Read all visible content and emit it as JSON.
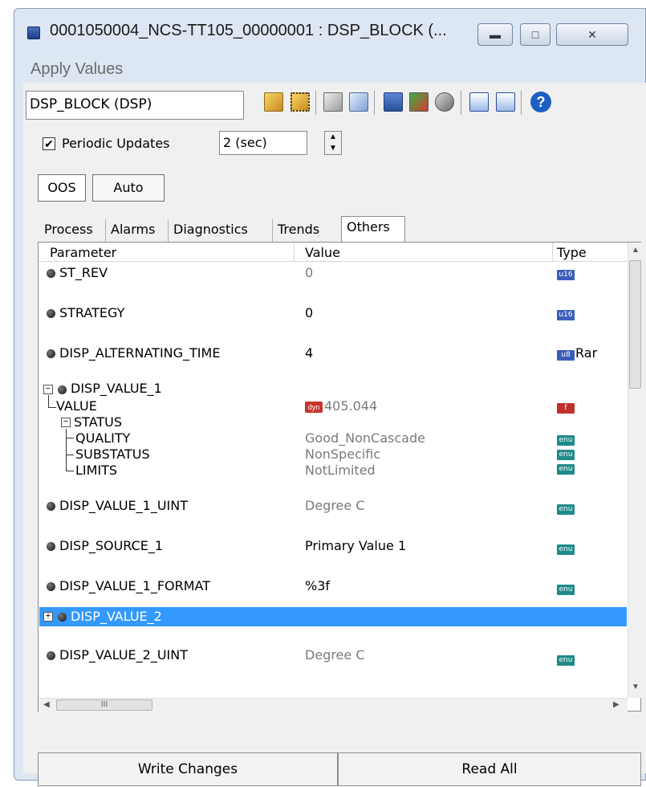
{
  "window": {
    "title": "0001050004_NCS-TT105_00000001 : DSP_BLOCK (..."
  },
  "menu": {
    "apply_values": "Apply Values"
  },
  "toolbar": {
    "block_name": "DSP_BLOCK (DSP)",
    "help_label": "?"
  },
  "controls": {
    "periodic_updates_label": "Periodic Updates",
    "periodic_updates_checked": true,
    "check_mark": "✔",
    "interval_value": "2 (sec)",
    "spin_up": "▲",
    "spin_down": "▼",
    "oos_label": "OOS",
    "auto_label": "Auto"
  },
  "tabs": [
    "Process",
    "Alarms",
    "Diagnostics",
    "Trends",
    "Others"
  ],
  "active_tab": "Others",
  "grid": {
    "columns": {
      "parameter": "Parameter",
      "value": "Value",
      "type": "Type"
    },
    "rows": {
      "st_rev": {
        "param": "ST_REV",
        "value": "0",
        "type": "u16"
      },
      "strategy": {
        "param": "STRATEGY",
        "value": "0",
        "type": "u16"
      },
      "disp_alt": {
        "param": "DISP_ALTERNATING_TIME",
        "value": "4",
        "type": "u8",
        "type_extra": "Rar"
      },
      "disp_value_1": {
        "param": "DISP_VALUE_1",
        "expand": "⊟"
      },
      "value": {
        "param": "VALUE",
        "value": "405.044",
        "dyn": "dyn",
        "type": "f"
      },
      "status": {
        "param": "STATUS"
      },
      "quality": {
        "param": "QUALITY",
        "value": "Good_NonCascade",
        "type": "enu"
      },
      "substatus": {
        "param": "SUBSTATUS",
        "value": "NonSpecific",
        "type": "enu"
      },
      "limits": {
        "param": "LIMITS",
        "value": "NotLimited",
        "type": "enu"
      },
      "disp_value_1_uint": {
        "param": "DISP_VALUE_1_UINT",
        "value": "Degree C",
        "type": "enu"
      },
      "disp_source_1": {
        "param": "DISP_SOURCE_1",
        "value": "Primary Value 1",
        "type": "enu"
      },
      "disp_value_1_format": {
        "param": "DISP_VALUE_1_FORMAT",
        "value": "%3f",
        "type": "enu"
      },
      "disp_value_2": {
        "param": "DISP_VALUE_2",
        "expand": "+"
      },
      "disp_value_2_uint": {
        "param": "DISP_VALUE_2_UINT",
        "value": "Degree C",
        "type": "enu"
      }
    },
    "hscroll_grip": "III"
  },
  "buttons": {
    "write_changes": "Write Changes",
    "read_all": "Read All"
  },
  "colors": {
    "selection": "#3399ff",
    "enum_badge": "#1f8a8a",
    "uint_badge": "#3a5fb8",
    "float_badge": "#c0302a"
  }
}
